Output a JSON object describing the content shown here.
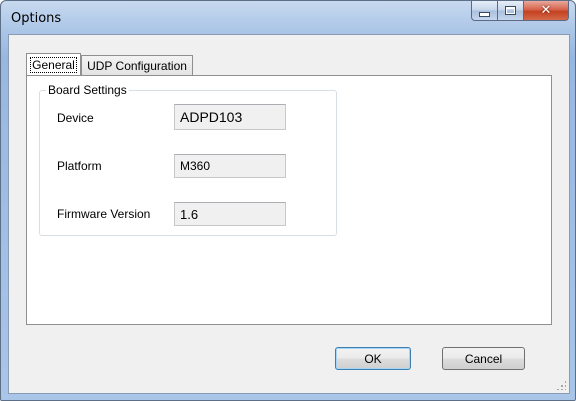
{
  "window": {
    "title": "Options"
  },
  "tabs": [
    {
      "label": "General",
      "active": true
    },
    {
      "label": "UDP Configuration",
      "active": false
    }
  ],
  "board_settings": {
    "group_title": "Board Settings",
    "fields": [
      {
        "label": "Device",
        "value": "ADPD103"
      },
      {
        "label": "Platform",
        "value": "M360"
      },
      {
        "label": "Firmware Version",
        "value": "1.6"
      }
    ]
  },
  "buttons": {
    "ok": "OK",
    "cancel": "Cancel"
  },
  "titlebar_icons": [
    "minimize-icon",
    "maximize-icon",
    "close-icon"
  ],
  "colors": {
    "frame": "#a9c5e8",
    "client_bg": "#f0f0f0",
    "close_button": "#c3411f"
  }
}
